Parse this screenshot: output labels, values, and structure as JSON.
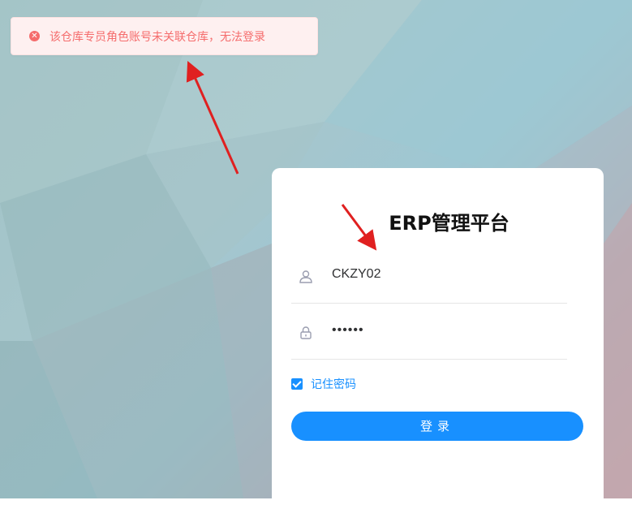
{
  "toast": {
    "icon": "error-circle-icon",
    "message": "该仓库专员角色账号未关联仓库，无法登录",
    "color": "#f56c6c"
  },
  "login": {
    "title": "ERP管理平台",
    "username": {
      "icon": "user-icon",
      "value": "CKZY02"
    },
    "password": {
      "icon": "lock-icon",
      "value": "••••••"
    },
    "remember": {
      "label": "记住密码",
      "checked": true
    },
    "submit_label": "登录"
  },
  "colors": {
    "accent": "#1890ff",
    "annotation_arrow": "#e02020"
  }
}
